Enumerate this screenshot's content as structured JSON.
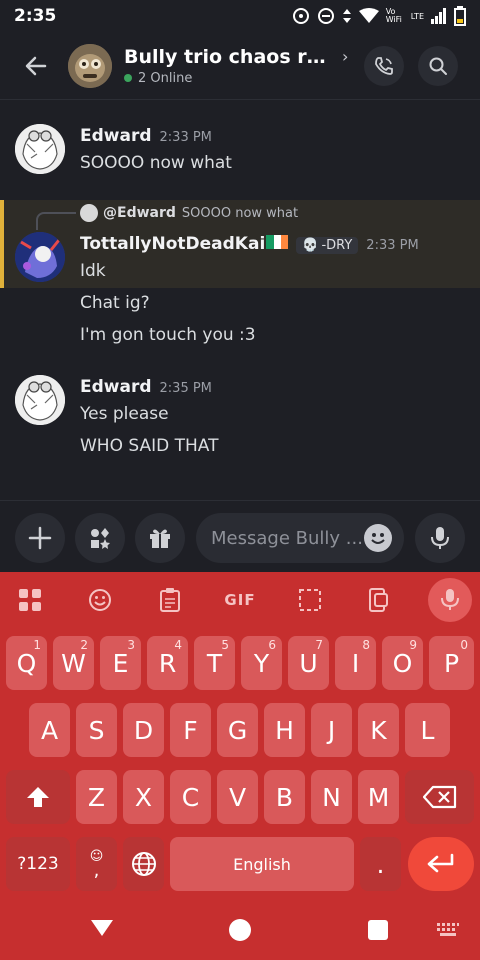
{
  "status_bar": {
    "time": "2:35",
    "network": "Vo WiFi",
    "lte": "LTE"
  },
  "header": {
    "title": "Bully trio chaos ro...",
    "online": "2 Online"
  },
  "messages": [
    {
      "author": "Edward",
      "time": "2:33 PM",
      "lines": [
        "SOOOO now what"
      ]
    },
    {
      "reply_to_name": "@Edward",
      "reply_to_text": "SOOOO now what",
      "author": "TottallyNotDeadKai",
      "tag": "-DRY",
      "time": "2:33 PM",
      "lines": [
        "Idk",
        "Chat ig?",
        "I'm gon touch you :3"
      ]
    },
    {
      "author": "Edward",
      "time": "2:35 PM",
      "lines": [
        "Yes please",
        "WHO SAID THAT"
      ]
    }
  ],
  "composer": {
    "placeholder": "Message Bully ..."
  },
  "keyboard": {
    "toolbar": {
      "gif": "GIF"
    },
    "row1": [
      {
        "k": "Q",
        "n": "1"
      },
      {
        "k": "W",
        "n": "2"
      },
      {
        "k": "E",
        "n": "3"
      },
      {
        "k": "R",
        "n": "4"
      },
      {
        "k": "T",
        "n": "5"
      },
      {
        "k": "Y",
        "n": "6"
      },
      {
        "k": "U",
        "n": "7"
      },
      {
        "k": "I",
        "n": "8"
      },
      {
        "k": "O",
        "n": "9"
      },
      {
        "k": "P",
        "n": "0"
      }
    ],
    "row2": [
      "A",
      "S",
      "D",
      "F",
      "G",
      "H",
      "J",
      "K",
      "L"
    ],
    "row3": [
      "Z",
      "X",
      "C",
      "V",
      "B",
      "N",
      "M"
    ],
    "sym": "?123",
    "comma": ",",
    "space": "English",
    "period": "."
  },
  "colors": {
    "accent_online": "#3ba55d",
    "reply_highlight": "#e0b13a",
    "keyboard": "#c62f2f"
  }
}
